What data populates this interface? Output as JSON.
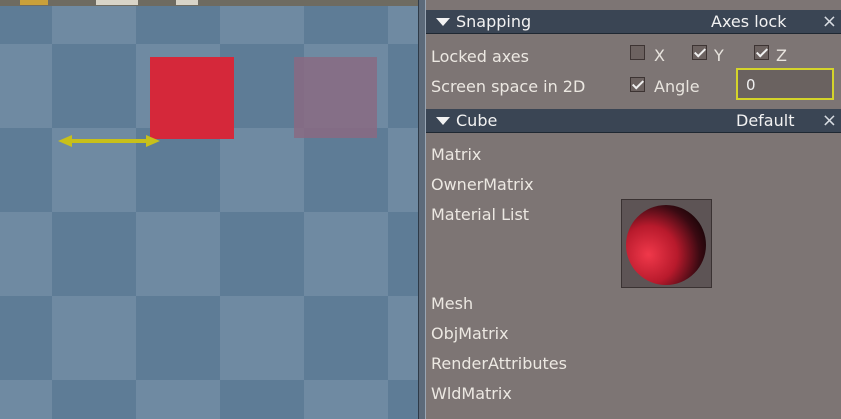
{
  "snapping": {
    "title": "Snapping",
    "mode": "Axes lock",
    "close": "×",
    "locked_axes_label": "Locked axes",
    "axes": [
      {
        "label": "X",
        "checked": false
      },
      {
        "label": "Y",
        "checked": true
      },
      {
        "label": "Z",
        "checked": true
      }
    ],
    "screen_space_label": "Screen space in 2D",
    "angle": {
      "label": "Angle",
      "checked": true,
      "value": "0"
    }
  },
  "cube": {
    "title": "Cube",
    "preset": "Default",
    "close": "×",
    "properties": [
      "Matrix",
      "OwnerMatrix",
      "Material List",
      "Mesh",
      "ObjMatrix",
      "RenderAttributes",
      "WldMatrix"
    ]
  },
  "colors": {
    "header_bg": "#3a4554",
    "panel_bg": "#7d7574",
    "cube_red": "#d5283a",
    "gizmo_yellow": "#c8c01a",
    "angle_focus": "#d4d42a"
  }
}
